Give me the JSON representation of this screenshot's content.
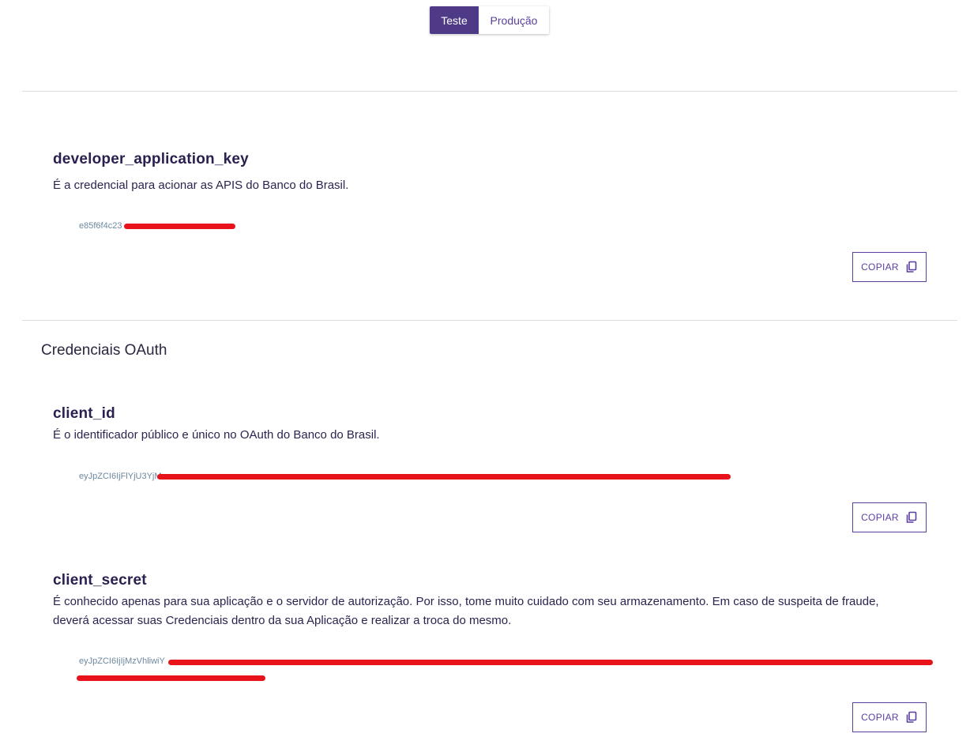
{
  "env_toggle": {
    "options": [
      {
        "label": "Teste",
        "selected": true
      },
      {
        "label": "Produção",
        "selected": false
      }
    ]
  },
  "app_key": {
    "title": "developer_application_key",
    "description": "É a credencial para acionar as APIS do Banco do Brasil.",
    "value": "e85f6f4c23",
    "copy_label": "COPIAR"
  },
  "oauth": {
    "heading": "Credenciais OAuth",
    "client_id": {
      "title": "client_id",
      "description": "É o identificador público e único no OAuth do Banco do Brasil.",
      "value": "eyJpZCI6IjFlYjU3YjM",
      "copy_label": "COPIAR"
    },
    "client_secret": {
      "title": "client_secret",
      "description_line1": "É conhecido apenas para sua aplicação e o servidor de autorização. Por isso, tome muito cuidado com seu armazenamento. Em caso de suspeita de fraude,",
      "description_line2": "deverá acessar suas Credenciais dentro da sua Aplicação e realizar a troca do mesmo.",
      "value": "eyJpZCI6IjIjMzVhliwiY",
      "copy_label": "COPIAR"
    }
  },
  "colors": {
    "accent": "#4f3a87",
    "accent_text": "#5b3fa0",
    "redaction": "#e8121b",
    "value_text": "#6c88a0"
  },
  "icons": {
    "copy": "copy-icon"
  }
}
